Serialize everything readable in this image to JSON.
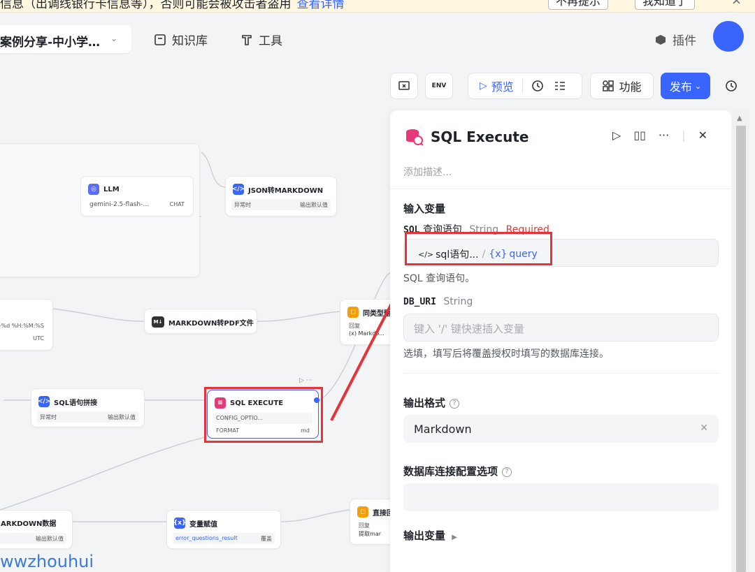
{
  "notice": {
    "text": "信息（出调线银行卡信息等），否则可能会被攻击者盗用",
    "link": "查看详情",
    "btn_no_remind": "不再提示",
    "btn_got_it": "我知道了",
    "close": "×"
  },
  "header": {
    "project_name": "案例分享-中小学…",
    "nav_knowledge": "知识库",
    "nav_tools": "工具",
    "nav_plugins": "插件"
  },
  "toolbar": {
    "preview": "预览",
    "features": "功能",
    "publish": "发布",
    "env_label": "ENV"
  },
  "nodes": {
    "llm": {
      "title": "LLM",
      "model": "gemini-2.5-flash-…",
      "tag": "CHAT"
    },
    "json_md": {
      "title": "JSON转MARKDOWN",
      "left": "异常时",
      "right": "输出默认值"
    },
    "date": {
      "line1": "n-%d %H:%M:%S",
      "line2": "UTC"
    },
    "md_pdf": {
      "title": "MARKDOWN转PDF文件"
    },
    "same_type": {
      "title": "同类型题型",
      "sub": "回复",
      "ref": "(x) Markdo..."
    },
    "sql_concat": {
      "title": "SQL语句拼接",
      "left": "异常时",
      "right": "输出默认值"
    },
    "sql_exec": {
      "title": "SQL EXECUTE",
      "row1": "CONFIG_OPTIO...",
      "row2_l": "FORMAT",
      "row2_r": "md"
    },
    "md_data": {
      "title": "ARKDOWN数据",
      "right": "输出默认值"
    },
    "var_assign": {
      "title": "变量赋值",
      "row": "error_questions_result",
      "tag": "覆盖"
    },
    "direct_reply": {
      "title": "直接回复",
      "sub": "回复",
      "ref": "提取mar"
    }
  },
  "panel": {
    "title": "SQL Execute",
    "desc": "添加描述...",
    "input_vars": "输入变量",
    "sql": {
      "name": "SQL",
      "desc_label": "查询语句",
      "type": "String",
      "required": "Required",
      "chip_node": "sql语句...",
      "chip_sep": "/",
      "chip_var": "query",
      "hint": "SQL 查询语句。"
    },
    "db_uri": {
      "name": "DB_URI",
      "type": "String",
      "placeholder": "键入 '/' 键快速插入变量",
      "hint": "选填，填写后将覆盖授权时填写的数据库连接。"
    },
    "output_format": {
      "label": "输出格式",
      "value": "Markdown"
    },
    "db_config": {
      "label": "数据库连接配置选项"
    },
    "output_vars": "输出变量"
  },
  "watermark": "wwzhouhui"
}
